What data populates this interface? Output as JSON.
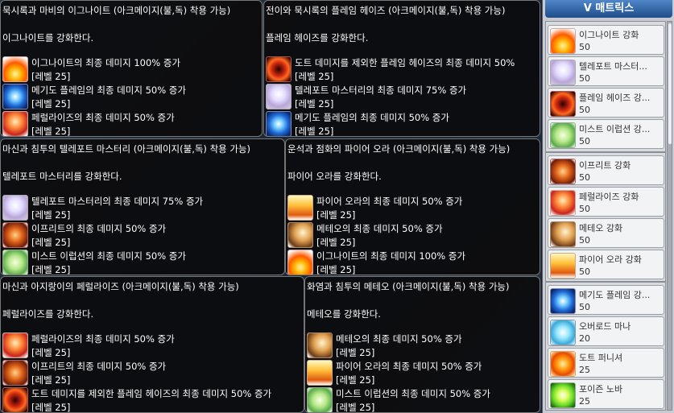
{
  "tooltips": [
    {
      "title": "묵시록과 마비의 이그나이트 (아크메이지(불,독) 착용 가능)",
      "desc": "이그나이트를 강화한다.",
      "items": [
        {
          "icon": "ignite-icon",
          "name": "이그나이트의 최종 데미지 100% 증가",
          "level": "[레벨 25]"
        },
        {
          "icon": "megido-flame-icon",
          "name": "메기도 플레임의 최종 데미지 50% 증가",
          "level": "[레벨 25]"
        },
        {
          "icon": "paralyze-icon",
          "name": "페럴라이즈의 최종 데미지 50% 증가",
          "level": "[레벨 25]"
        }
      ]
    },
    {
      "title": "전이와 묵시록의 플레임 헤이즈 (아크메이지(불,독) 착용 가능)",
      "desc": "플레임 헤이즈를 강화한다.",
      "items": [
        {
          "icon": "flame-haze-icon",
          "name": "도트 데미지를 제외한 플레임 헤이즈의 최종 데미지 50%",
          "level": "[레벨 25]"
        },
        {
          "icon": "teleport-mastery-icon",
          "name": "텔레포트 마스터리의 최종 데미지 75% 증가",
          "level": "[레벨 25]"
        },
        {
          "icon": "megido-flame-icon",
          "name": "메기도 플레임의 최종 데미지 50% 증가",
          "level": "[레벨 25]"
        }
      ]
    },
    {
      "title": "마신과 침투의 텔레포트 마스터리 (아크메이지(불,독) 착용 가능)",
      "desc": "텔레포트 마스터리를 강화한다.",
      "items": [
        {
          "icon": "teleport-mastery-icon",
          "name": "텔레포트 마스터리의 최종 데미지 75% 증가",
          "level": "[레벨 25]"
        },
        {
          "icon": "ifrit-icon",
          "name": "이프리트의 최종 데미지 50% 증가",
          "level": "[레벨 25]"
        },
        {
          "icon": "mist-eruption-icon",
          "name": "미스트 이럽션의 최종 데미지 50% 증가",
          "level": "[레벨 25]"
        }
      ]
    },
    {
      "title": "운석과 점화의 파이어 오라 (아크메이지(불,독) 착용 가능)",
      "desc": "파이어 오라를 강화한다.",
      "items": [
        {
          "icon": "fire-aura-icon",
          "name": "파이어 오라의 최종 데미지 50% 증가",
          "level": "[레벨 25]"
        },
        {
          "icon": "meteor-icon",
          "name": "메테오의 최종 데미지 50% 증가",
          "level": "[레벨 25]"
        },
        {
          "icon": "ignite-icon",
          "name": "이그나이트의 최종 데미지 100% 증가",
          "level": "[레벨 25]"
        }
      ]
    },
    {
      "title": "마신과 아지랑이의 페럴라이즈 (아크메이지(불,독) 착용 가능)",
      "desc": "페럴라이즈를 강화한다.",
      "items": [
        {
          "icon": "paralyze-icon",
          "name": "페럴라이즈의 최종 데미지 50% 증가",
          "level": "[레벨 25]"
        },
        {
          "icon": "ifrit-icon",
          "name": "이프리트의 최종 데미지 50% 증가",
          "level": "[레벨 25]"
        },
        {
          "icon": "flame-haze-icon",
          "name": "도트 데미지를 제외한 플레임 헤이즈의 최종 데미지 50% 증가",
          "level": "[레벨 25]"
        }
      ]
    },
    {
      "title": "화염과 침투의 메테오 (아크메이지(불,독) 착용 가능)",
      "desc": "메테오를 강화한다.",
      "items": [
        {
          "icon": "meteor-icon",
          "name": "메테오의 최종 데미지 50% 증가",
          "level": "[레벨 25]"
        },
        {
          "icon": "fire-aura-icon",
          "name": "파이어 오라의 최종 데미지 50% 증가",
          "level": "[레벨 25]"
        },
        {
          "icon": "mist-eruption-icon",
          "name": "미스트 이럽션의 최종 데미지 50% 증가",
          "level": "[레벨 25]"
        }
      ]
    }
  ],
  "matrix": {
    "title": "V 매트릭스",
    "items": [
      {
        "icon": "ignite-icon",
        "name": "이그나이트 강화",
        "value": "50"
      },
      {
        "icon": "teleport-mastery-icon",
        "name": "텔레포트 마스터...",
        "value": "50"
      },
      {
        "icon": "flame-haze-icon",
        "name": "플레임 헤이즈 강...",
        "value": "50"
      },
      {
        "icon": "mist-eruption-icon",
        "name": "미스트 이럽션 강...",
        "value": "50"
      },
      {
        "icon": "ifrit-icon",
        "name": "이프리트 강화",
        "value": "50"
      },
      {
        "icon": "paralyze-icon",
        "name": "페럴라이즈 강화",
        "value": "50"
      },
      {
        "icon": "meteor-icon",
        "name": "메테오 강화",
        "value": "50"
      },
      {
        "icon": "fire-aura-icon",
        "name": "파이어 오라 강화",
        "value": "50"
      },
      {
        "icon": "megido-flame-icon",
        "name": "메기도 플레임 강...",
        "value": "50"
      },
      {
        "icon": "overload-mana-icon",
        "name": "오버로드 마나",
        "value": "20"
      },
      {
        "icon": "dot-punisher-icon",
        "name": "도트 퍼니셔",
        "value": "25"
      },
      {
        "icon": "poison-nova-icon",
        "name": "포이즌 노바",
        "value": "25"
      }
    ]
  }
}
